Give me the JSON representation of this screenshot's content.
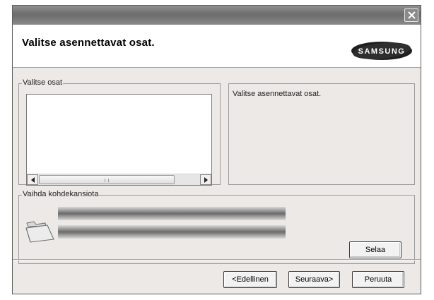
{
  "window": {
    "close_icon": "close-icon"
  },
  "header": {
    "title": "Valitse asennettavat osat.",
    "logo_text": "SAMSUNG"
  },
  "components_group": {
    "legend": "Valitse osat",
    "items": [],
    "scrollbar": {
      "left_icon": "arrow-left-icon",
      "right_icon": "arrow-right-icon"
    }
  },
  "description": {
    "text": "Valitse asennettavat osat."
  },
  "destination_group": {
    "legend": "Vaihda kohdekansiota",
    "icon": "folder-icon",
    "browse_label": "Selaa"
  },
  "footer": {
    "back_label": "<Edellinen",
    "next_label": "Seuraava>",
    "cancel_label": "Peruuta"
  },
  "colors": {
    "window_bg": "#ece9e6",
    "titlebar": "#7a7a7a",
    "logo_blue": "#2a2a2a"
  }
}
